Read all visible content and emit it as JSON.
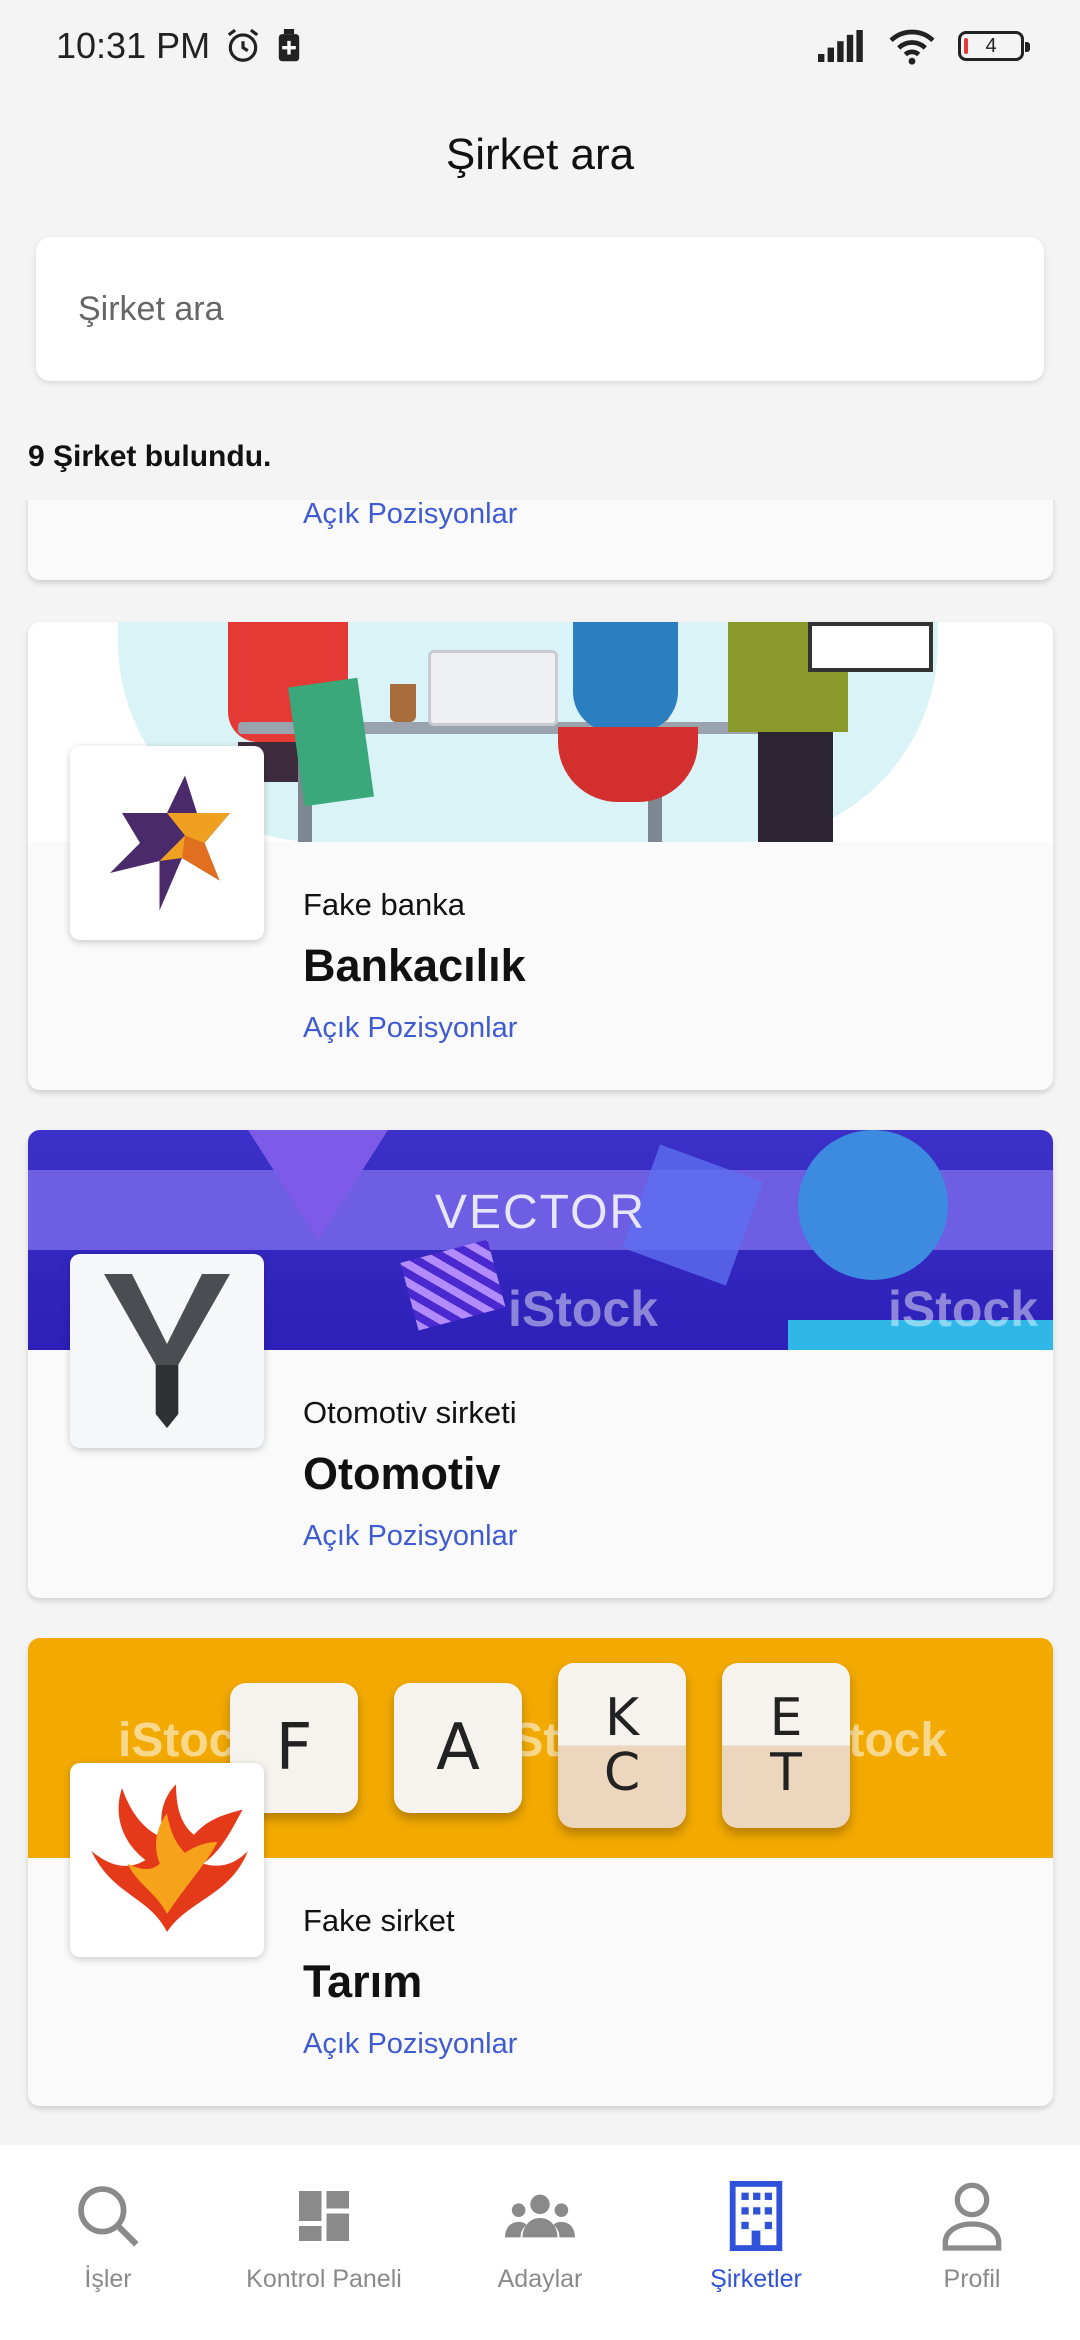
{
  "status_bar": {
    "time": "10:31 PM",
    "battery_level": "4"
  },
  "header": {
    "title": "Şirket ara"
  },
  "search": {
    "placeholder": "Şirket ara",
    "value": ""
  },
  "results": {
    "count_text": "9 Şirket bulundu."
  },
  "cards": [
    {
      "open_positions_label": "Açık Pozisyonlar"
    },
    {
      "company": "Fake banka",
      "sector": "Bankacılık",
      "open_positions_label": "Açık Pozisyonlar",
      "banner": "office-meeting-illustration",
      "logo": "star-arrow-logo"
    },
    {
      "company": "Otomotiv sirketi",
      "sector": "Otomotiv",
      "open_positions_label": "Açık Pozisyonlar",
      "banner": "vector-abstract-banner",
      "banner_text": "VECTOR",
      "watermark": "iStock",
      "logo": "y-letter-logo"
    },
    {
      "company": "Fake sirket",
      "sector": "Tarım",
      "open_positions_label": "Açık Pozisyonlar",
      "banner": "fake-letter-tiles",
      "tiles": [
        "F",
        "A",
        "K",
        "C",
        "E",
        "T"
      ],
      "watermark": "iStock",
      "logo": "phoenix-logo"
    }
  ],
  "bottom_nav": [
    {
      "label": "İşler",
      "icon": "search-icon",
      "active": false
    },
    {
      "label": "Kontrol Paneli",
      "icon": "dashboard-icon",
      "active": false
    },
    {
      "label": "Adaylar",
      "icon": "people-icon",
      "active": false
    },
    {
      "label": "Şirketler",
      "icon": "building-icon",
      "active": true
    },
    {
      "label": "Profil",
      "icon": "profile-icon",
      "active": false
    }
  ],
  "colors": {
    "accent": "#2f52d9",
    "link": "#3f5bd1",
    "background": "#f4f4f4"
  }
}
